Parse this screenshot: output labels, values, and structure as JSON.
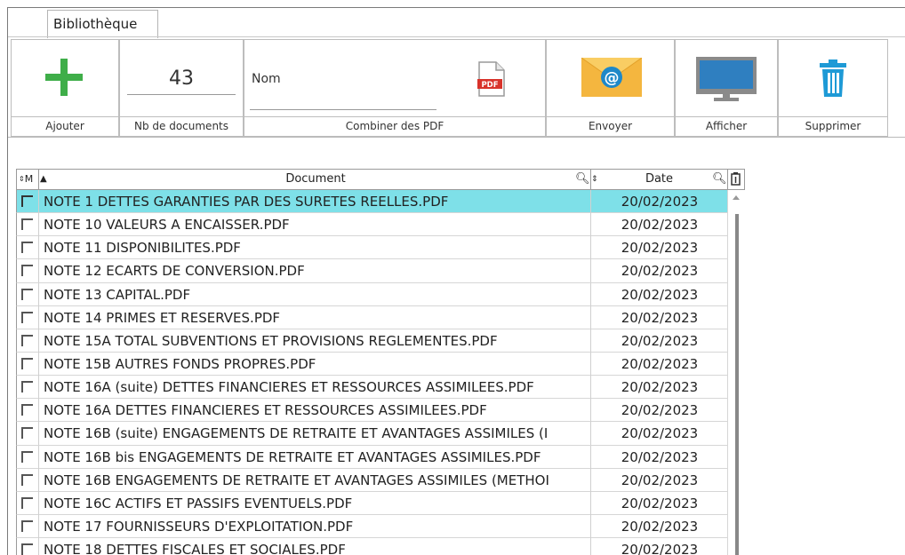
{
  "tab": {
    "label": "Bibliothèque"
  },
  "ribbon": {
    "add_label": "Ajouter",
    "count_label": "Nb de documents",
    "count_value": "43",
    "combine_label": "Combiner des PDF",
    "name_label": "Nom",
    "pdf_icon_text": "PDF",
    "send_label": "Envoyer",
    "view_label": "Afficher",
    "delete_label": "Supprimer"
  },
  "grid": {
    "columns": {
      "m": "M",
      "document": "Document",
      "date": "Date"
    },
    "rows": [
      {
        "name": "NOTE 1 DETTES GARANTIES PAR DES SURETES REELLES.PDF",
        "date": "20/02/2023"
      },
      {
        "name": "NOTE 10 VALEURS A ENCAISSER.PDF",
        "date": "20/02/2023"
      },
      {
        "name": "NOTE 11 DISPONIBILITES.PDF",
        "date": "20/02/2023"
      },
      {
        "name": "NOTE 12 ECARTS DE CONVERSION.PDF",
        "date": "20/02/2023"
      },
      {
        "name": "NOTE 13 CAPITAL.PDF",
        "date": "20/02/2023"
      },
      {
        "name": "NOTE 14 PRIMES ET RESERVES.PDF",
        "date": "20/02/2023"
      },
      {
        "name": "NOTE 15A TOTAL SUBVENTIONS ET PROVISIONS REGLEMENTES.PDF",
        "date": "20/02/2023"
      },
      {
        "name": "NOTE 15B AUTRES FONDS PROPRES.PDF",
        "date": "20/02/2023"
      },
      {
        "name": "NOTE 16A (suite) DETTES FINANCIERES ET RESSOURCES ASSIMILEES.PDF",
        "date": "20/02/2023"
      },
      {
        "name": "NOTE 16A DETTES FINANCIERES ET RESSOURCES ASSIMILEES.PDF",
        "date": "20/02/2023"
      },
      {
        "name": "NOTE 16B (suite) ENGAGEMENTS DE RETRAITE ET AVANTAGES ASSIMILES (I",
        "date": "20/02/2023"
      },
      {
        "name": "NOTE 16B bis ENGAGEMENTS DE RETRAITE ET AVANTAGES ASSIMILES.PDF",
        "date": "20/02/2023"
      },
      {
        "name": "NOTE 16B ENGAGEMENTS DE RETRAITE ET AVANTAGES ASSIMILES (METHOI",
        "date": "20/02/2023"
      },
      {
        "name": "NOTE 16C ACTIFS ET PASSIFS EVENTUELS.PDF",
        "date": "20/02/2023"
      },
      {
        "name": "NOTE 17 FOURNISSEURS D'EXPLOITATION.PDF",
        "date": "20/02/2023"
      },
      {
        "name": "NOTE 18 DETTES FISCALES ET SOCIALES.PDF",
        "date": "20/02/2023"
      }
    ]
  },
  "colors": {
    "selected_row": "#7ee0e8",
    "add_green": "#3fae49",
    "trash_blue": "#1e9ad6",
    "envelope": "#f4b63f"
  }
}
